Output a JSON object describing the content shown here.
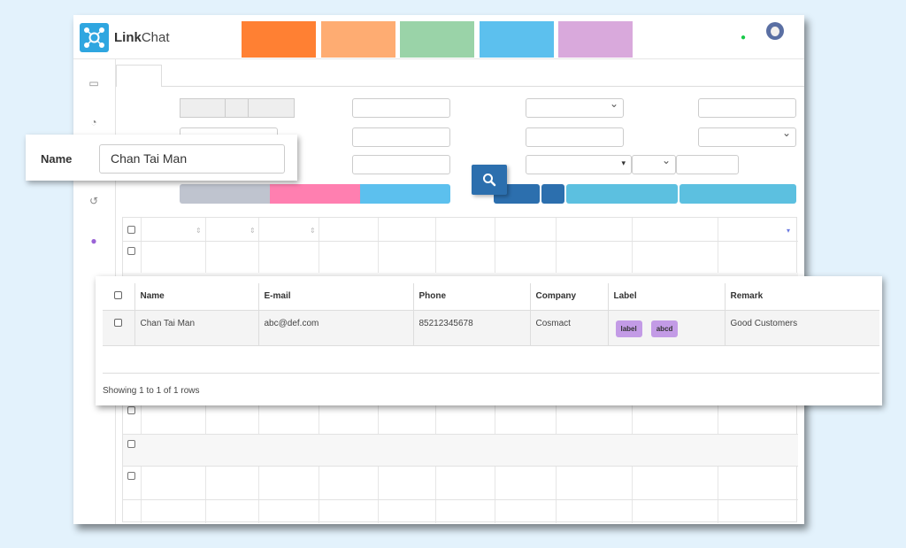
{
  "app": {
    "brand_bold": "Link",
    "brand_rest": "Chat"
  },
  "colors": {
    "orange": "#ff8033",
    "peach": "#feac72",
    "green": "#9ad3a8",
    "blue": "#5cc0ee",
    "purple": "#d9a9dc",
    "search": "#2c6fae",
    "tag": "#c39be6"
  },
  "sidebar": {
    "icons": [
      "chat-icon",
      "contact-icon",
      "history-icon",
      "user-circle-icon"
    ]
  },
  "name_filter": {
    "label": "Name",
    "value": "Chan Tai Man"
  },
  "result_table": {
    "headers": [
      "Name",
      "E-mail",
      "Phone",
      "Company",
      "Label",
      "Remark"
    ],
    "rows": [
      {
        "name": "Chan Tai Man",
        "email": "abc@def.com",
        "phone": "85212345678",
        "company": "Cosmact",
        "labels": [
          "label",
          "abcd"
        ],
        "remark": "Good Customers"
      }
    ],
    "footer": "Showing 1 to 1 of 1 rows"
  }
}
